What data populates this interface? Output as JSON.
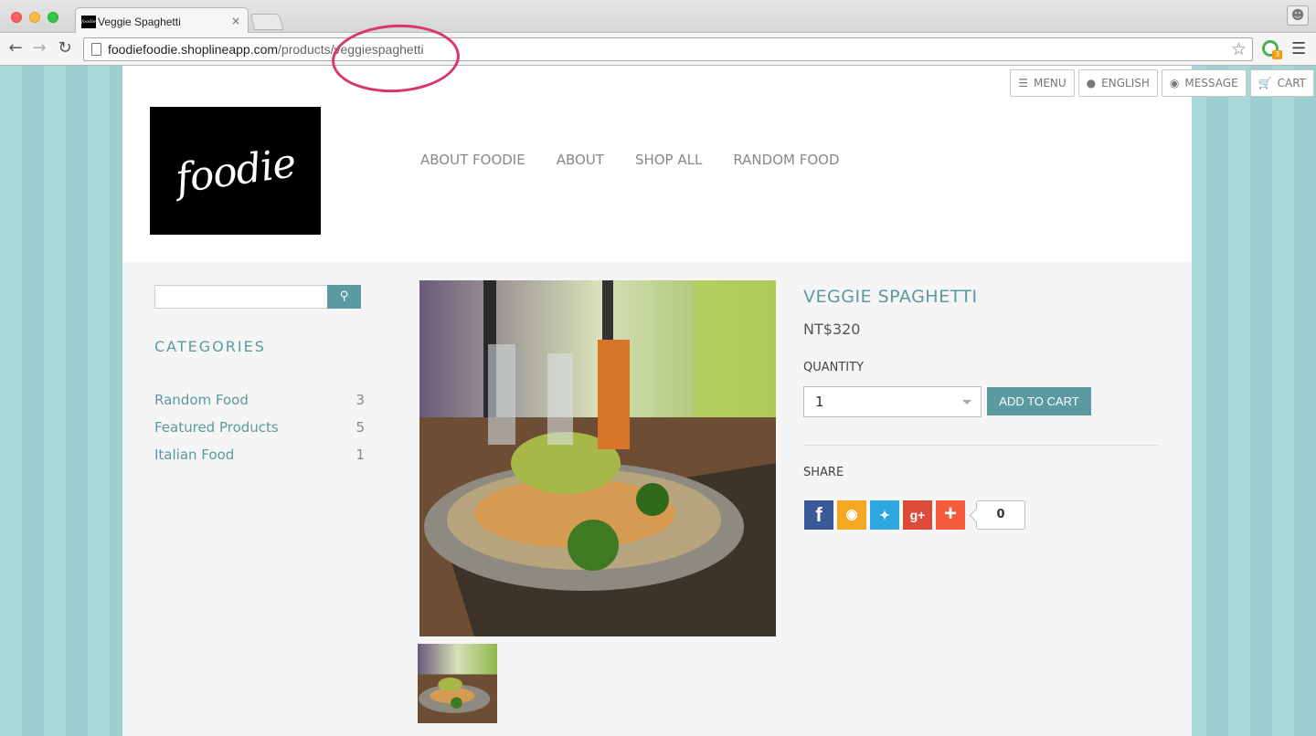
{
  "browser": {
    "tab_title": "Veggie Spaghetti",
    "tab_close": "×",
    "url_host": "foodiefoodie.shoplineapp.com",
    "url_path": "/products/veggiespaghetti",
    "ext_badge": "3"
  },
  "topbar": {
    "menu": "MENU",
    "language": "ENGLISH",
    "message": "MESSAGE",
    "cart": "CART"
  },
  "logo_text": "foodie",
  "nav": [
    "ABOUT FOODIE",
    "ABOUT",
    "SHOP ALL",
    "RANDOM FOOD"
  ],
  "sidebar": {
    "search_placeholder": "",
    "categories_title": "CATEGORIES",
    "categories": [
      {
        "name": "Random Food",
        "count": "3"
      },
      {
        "name": "Featured Products",
        "count": "5"
      },
      {
        "name": "Italian Food",
        "count": "1"
      }
    ]
  },
  "product": {
    "title": "VEGGIE SPAGHETTI",
    "price": "NT$320",
    "quantity_label": "QUANTITY",
    "quantity_value": "1",
    "add_to_cart": "ADD TO CART",
    "share_label": "SHARE",
    "share_count": "0"
  },
  "colors": {
    "accent": "#5a9aa0",
    "background_stripe": "#a8d7d8",
    "annotation": "#d9366d"
  }
}
